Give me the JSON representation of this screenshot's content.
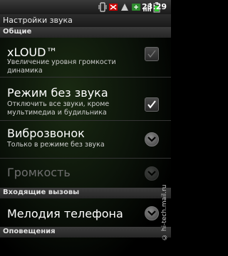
{
  "status_bar": {
    "time": "23:29",
    "icons": [
      "vibrate-icon",
      "battery-alert-icon",
      "network-icon",
      "usb-icon",
      "signal-icon",
      "battery-icon"
    ]
  },
  "screen": {
    "title": "Настройки звука"
  },
  "sections": {
    "general": {
      "header": "Общие"
    },
    "incoming": {
      "header": "Входящие вызовы"
    },
    "notifications": {
      "header": "Оповещения"
    }
  },
  "settings": {
    "xloud": {
      "title": "xLOUD™",
      "summary": "Увеличение уровня громкости динамика",
      "checked": false
    },
    "silent": {
      "title": "Режим без звука",
      "summary": "Отключить все звуки, кроме мультимедиа и будильника",
      "checked": true
    },
    "vibrate": {
      "title": "Виброзвонок",
      "summary": "Только в режиме без звука"
    },
    "volume": {
      "title": "Громкость",
      "enabled": false
    },
    "ringtone": {
      "title": "Мелодия телефона"
    }
  },
  "watermark": "© hi-tech.mail.ru"
}
